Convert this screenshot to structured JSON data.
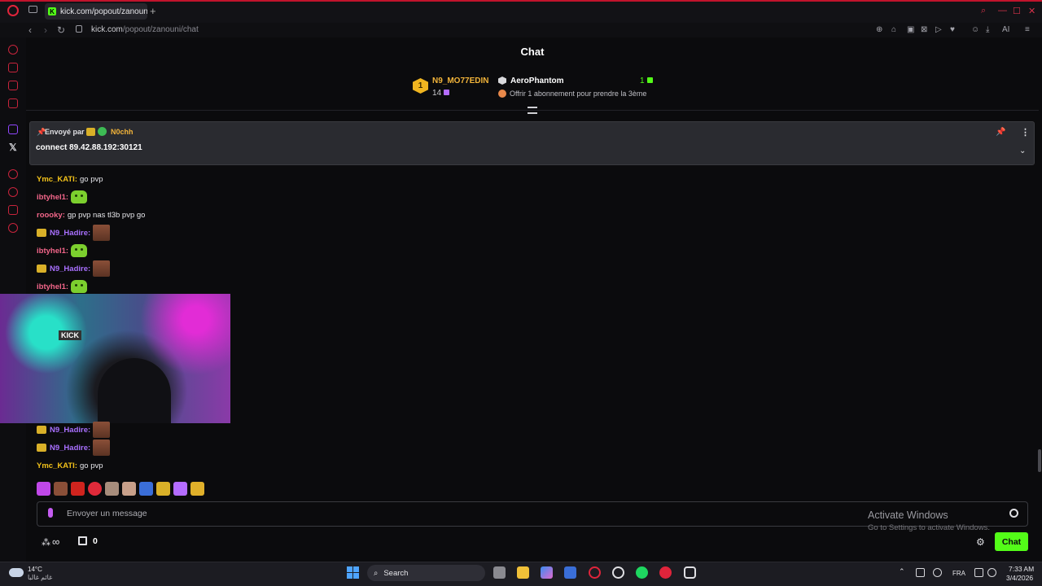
{
  "browser": {
    "tab_title": "kick.com/popout/zanouni/",
    "url_host": "kick.com",
    "url_path": "/popout/zanouni/chat",
    "ext_ai_label": "AI"
  },
  "chat": {
    "title": "Chat",
    "leaderboard": {
      "first": {
        "rank": "1",
        "name": "N9_MO77EDIN",
        "count": "14"
      },
      "second": {
        "name": "AeroPhantom",
        "count": "1"
      },
      "offer_text": "Offrir 1 abonnement pour prendre la 3ème"
    },
    "pinned": {
      "label": "Envoyé par",
      "user": "N0chh",
      "text": "connect 89.42.88.192:30121"
    },
    "messages": [
      {
        "user": "Ymc_KATI",
        "text": "go pvp"
      },
      {
        "user": "ibtyhel1",
        "emote": "green-blob"
      },
      {
        "user": "roooky",
        "text": "gp pvp nas tl3b pvp go"
      },
      {
        "user": "N9_Hadire",
        "emote": "face"
      },
      {
        "user": "ibtyhel1",
        "emote": "green-blob"
      },
      {
        "user": "N9_Hadire",
        "emote": "face"
      },
      {
        "user": "ibtyhel1",
        "emote": "green-blob"
      },
      {
        "user": "N9_Hadire",
        "emote": "face"
      },
      {
        "user": "N9_Hadire",
        "emote": "face"
      },
      {
        "user": "Ymc_KATI",
        "text": "go pvp"
      }
    ],
    "stream_logo": "KICK",
    "input_placeholder": "Envoyer un message",
    "points_value": "∞",
    "gift_count": "0",
    "chat_button": "Chat"
  },
  "watermark": {
    "title": "Activate Windows",
    "subtitle": "Go to Settings to activate Windows."
  },
  "taskbar": {
    "temperature": "14°C",
    "weather_desc": "غائم غالبا",
    "search_label": "Search",
    "language": "FRA",
    "time": "7:33 AM",
    "date": "3/4/2026"
  },
  "colors": {
    "accent_green": "#53fc18",
    "opera_red": "#e0243b",
    "user_yellow": "#f2c21a",
    "user_pink": "#f3668a",
    "user_purple": "#a970ff"
  }
}
